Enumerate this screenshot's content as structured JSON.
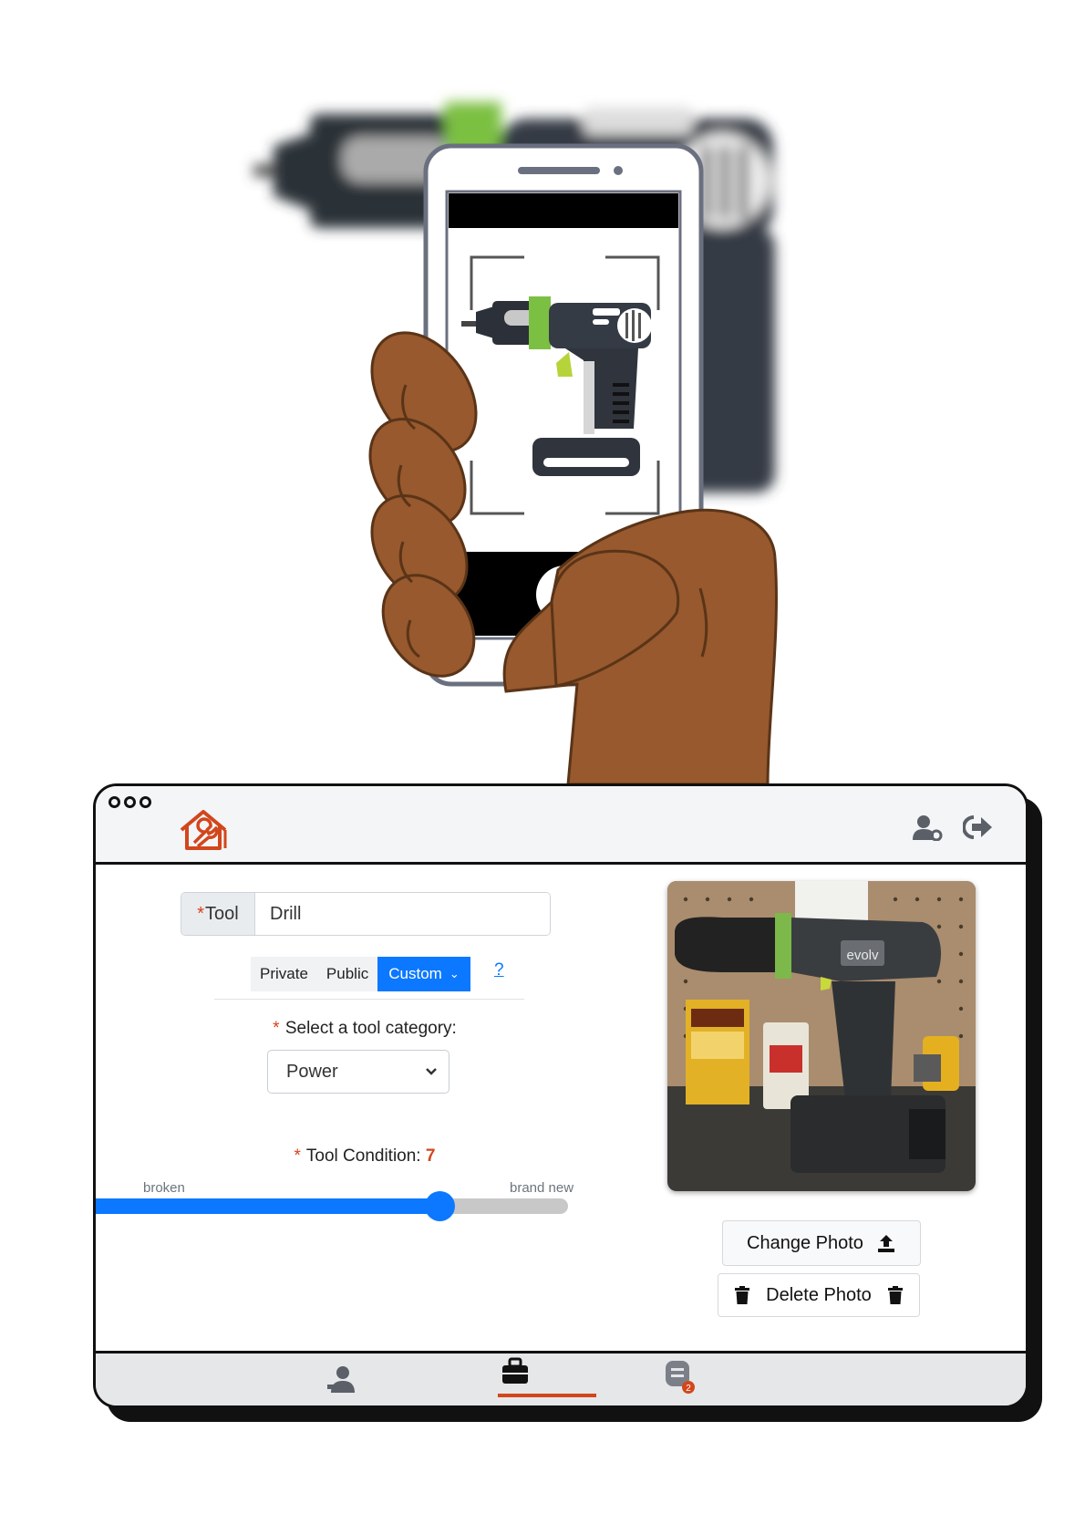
{
  "header": {
    "logo_icon": "house-wrench-logo-icon",
    "actions": [
      {
        "name": "user-settings-icon"
      },
      {
        "name": "logout-icon"
      }
    ]
  },
  "form": {
    "tool": {
      "required_mark": "*",
      "label": "Tool",
      "value": "Drill"
    },
    "visibility": {
      "options": [
        "Private",
        "Public",
        "Custom"
      ],
      "selected": "Custom",
      "help_label": "?"
    },
    "category": {
      "required_mark": "*",
      "label": "Select a tool category:",
      "selected": "Power"
    },
    "condition": {
      "required_mark": "*",
      "label": "Tool Condition:",
      "value": "7",
      "min_label": "broken",
      "max_label": "brand new",
      "level_fraction": 0.7
    }
  },
  "photo": {
    "brand_text": "evolv",
    "change_label": "Change Photo",
    "delete_label": "Delete Photo"
  },
  "bottom_nav": {
    "items": [
      {
        "name": "profile-nav-icon"
      },
      {
        "name": "toolbox-nav-icon",
        "active": true
      },
      {
        "name": "messages-nav-icon",
        "badge": "2"
      }
    ]
  },
  "colors": {
    "accent_orange": "#d2461c",
    "primary_blue": "#0b78ff",
    "skin": "#97592d"
  }
}
